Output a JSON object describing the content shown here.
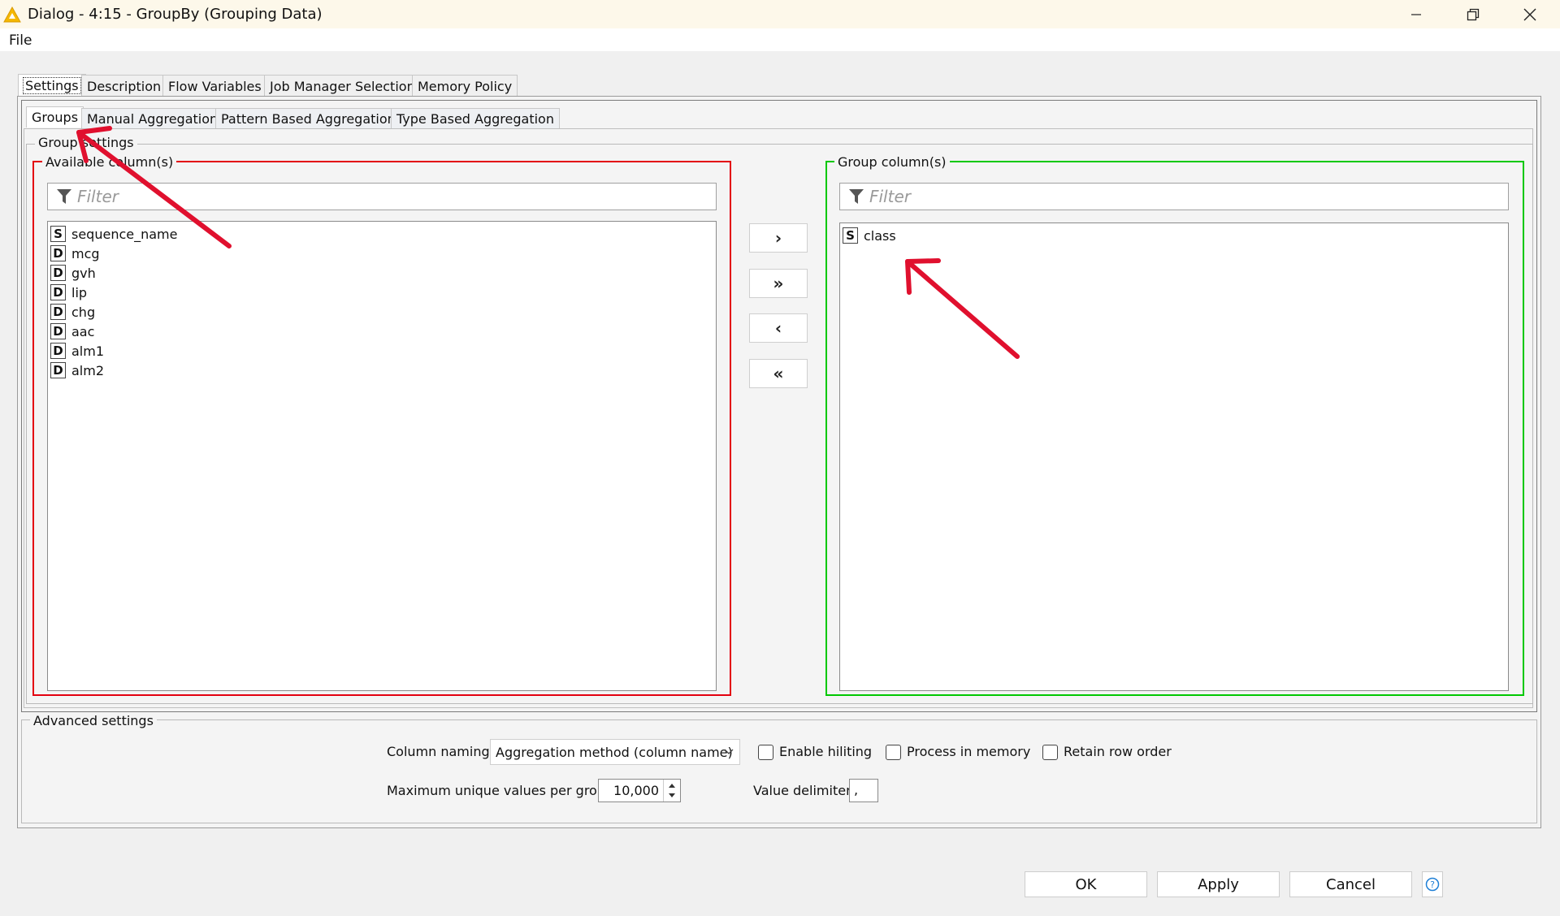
{
  "window": {
    "title": "Dialog - 4:15 - GroupBy (Grouping Data)",
    "minimize_icon": "minimize-icon",
    "maximize_icon": "restore-icon",
    "close_icon": "close-icon"
  },
  "menu": {
    "file": "File"
  },
  "tabs": [
    {
      "label": "Settings"
    },
    {
      "label": "Description"
    },
    {
      "label": "Flow Variables"
    },
    {
      "label": "Job Manager Selection"
    },
    {
      "label": "Memory Policy"
    }
  ],
  "subtabs": [
    {
      "label": "Groups"
    },
    {
      "label": "Manual Aggregation"
    },
    {
      "label": "Pattern Based Aggregation"
    },
    {
      "label": "Type Based Aggregation"
    }
  ],
  "group_settings": {
    "legend": "Group settings",
    "available": {
      "legend": "Available column(s)",
      "filter_placeholder": "Filter",
      "items": [
        {
          "type": "S",
          "name": "sequence_name"
        },
        {
          "type": "D",
          "name": "mcg"
        },
        {
          "type": "D",
          "name": "gvh"
        },
        {
          "type": "D",
          "name": "lip"
        },
        {
          "type": "D",
          "name": "chg"
        },
        {
          "type": "D",
          "name": "aac"
        },
        {
          "type": "D",
          "name": "alm1"
        },
        {
          "type": "D",
          "name": "alm2"
        }
      ]
    },
    "buttons": {
      "add": "›",
      "add_all": "»",
      "remove": "‹",
      "remove_all": "«"
    },
    "group": {
      "legend": "Group column(s)",
      "filter_placeholder": "Filter",
      "items": [
        {
          "type": "S",
          "name": "class"
        }
      ]
    }
  },
  "advanced": {
    "legend": "Advanced settings",
    "column_naming_label": "Column naming:",
    "column_naming_value": "Aggregation method (column name)",
    "enable_hiliting": "Enable hiliting",
    "process_in_memory": "Process in memory",
    "retain_row_order": "Retain row order",
    "max_unique_label": "Maximum unique values per group",
    "max_unique_value": "10,000",
    "value_delimiter_label": "Value delimiter",
    "value_delimiter_value": ","
  },
  "footer": {
    "ok": "OK",
    "apply": "Apply",
    "cancel": "Cancel",
    "help_icon": "help-icon"
  },
  "colors": {
    "available_border": "#e3000f",
    "group_border": "#00c800",
    "annotation_arrow": "#e0102e"
  }
}
